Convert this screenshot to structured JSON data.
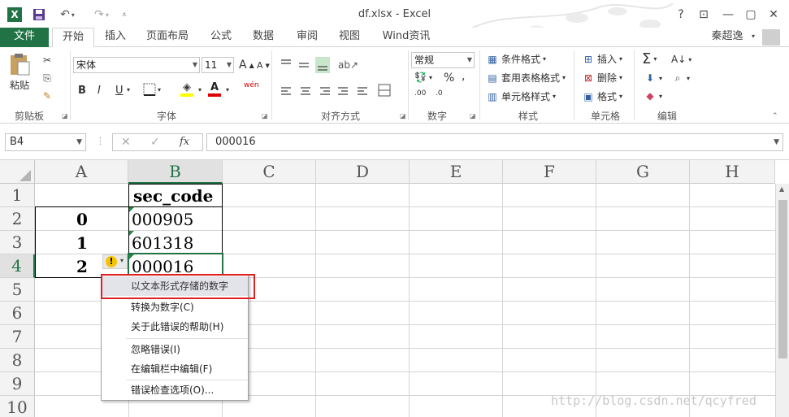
{
  "window": {
    "title": "df.xlsx - Excel",
    "app_icon": "X",
    "controls": [
      "?",
      "⊡",
      "—",
      "▢",
      "✕"
    ]
  },
  "tabs": [
    "文件",
    "开始",
    "插入",
    "页面布局",
    "公式",
    "数据",
    "审阅",
    "视图",
    "Wind资讯"
  ],
  "user": "秦超逸",
  "ribbon": {
    "clipboard": {
      "paste": "粘贴",
      "label": "剪贴板"
    },
    "font": {
      "name": "宋体",
      "size": "11",
      "label": "字体",
      "bold": "B",
      "italic": "I",
      "underline": "U",
      "wen": "wén",
      "grow": "A",
      "shrink": "A"
    },
    "alignment": {
      "label": "对齐方式"
    },
    "number": {
      "format": "常规",
      "label": "数字",
      "percent": "%"
    },
    "styles": {
      "conditional": "条件格式",
      "table": "套用表格格式",
      "cell": "单元格样式",
      "label": "样式"
    },
    "cells": {
      "insert": "插入",
      "delete": "删除",
      "format": "格式",
      "label": "单元格"
    },
    "editing": {
      "sum": "Σ",
      "label": "编辑"
    }
  },
  "formula_bar": {
    "name_box": "B4",
    "cancel": "✕",
    "enter": "✓",
    "fx": "fx",
    "formula": "000016"
  },
  "grid": {
    "columns": [
      "A",
      "B",
      "C",
      "D",
      "E",
      "F",
      "G",
      "H"
    ],
    "rows": [
      "1",
      "2",
      "3",
      "4",
      "5",
      "6",
      "7",
      "8",
      "9",
      "10"
    ],
    "cells": {
      "B1": "sec_code",
      "A2": "0",
      "B2": "000905",
      "A3": "1",
      "B3": "601318",
      "A4": "2",
      "B4": "000016"
    }
  },
  "error_menu": {
    "header": "以文本形式存储的数字",
    "items": [
      "转换为数字(C)",
      "关于此错误的帮助(H)",
      "忽略错误(I)",
      "在编辑栏中编辑(F)",
      "错误检查选项(O)..."
    ]
  },
  "watermark": "http://blog.csdn.net/qcyfred",
  "accent_color": "#217346"
}
